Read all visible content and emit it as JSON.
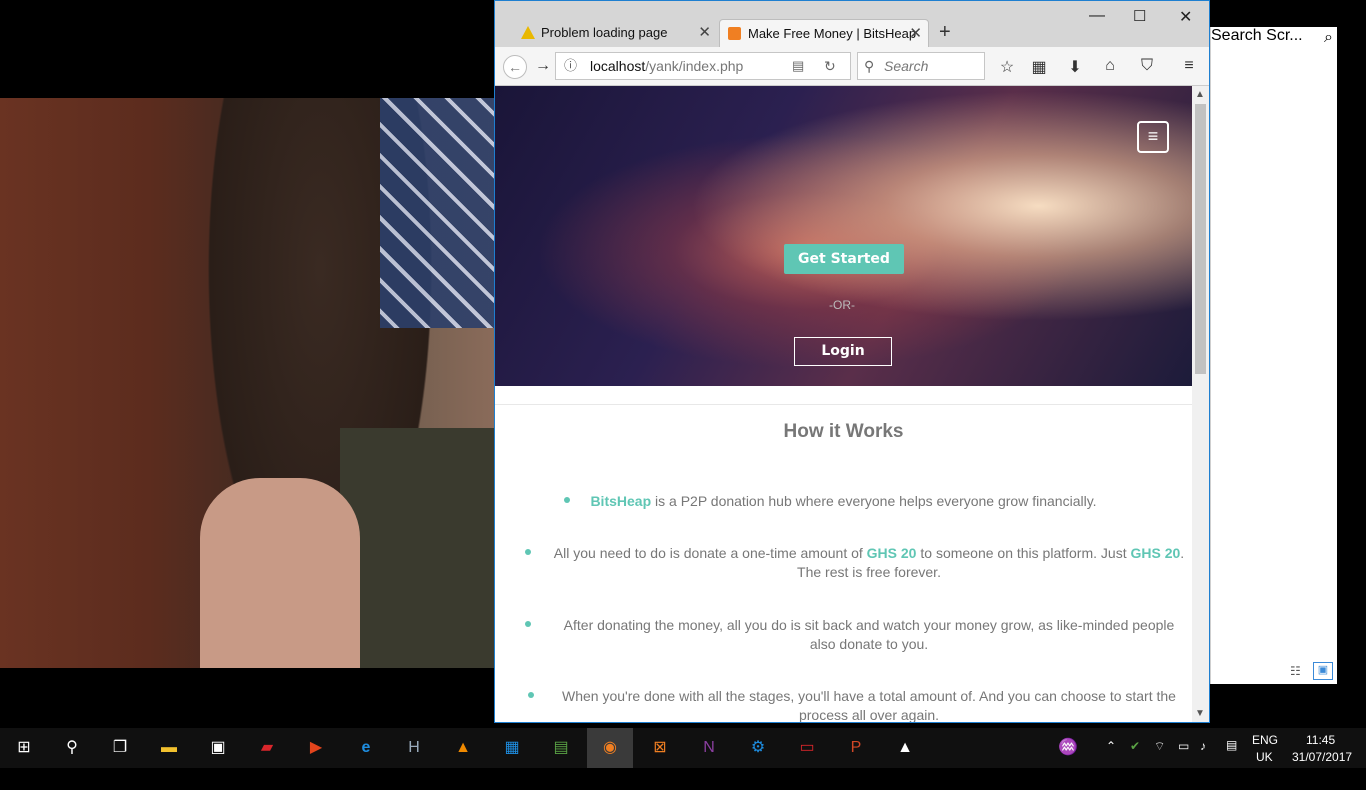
{
  "browser": {
    "tabs": [
      {
        "label": "Problem loading page",
        "icon": "warning-icon"
      },
      {
        "label": "Make Free Money | BitsHeap",
        "icon": "xampp-icon"
      }
    ],
    "url_host": "localhost",
    "url_path": "/yank/index.php",
    "search_placeholder": "Search"
  },
  "page": {
    "get_started_label": "Get Started",
    "or_label": "-OR-",
    "login_label": "Login",
    "how_title": "How it Works",
    "items": [
      {
        "parts": [
          "BitsHeap",
          " is a P2P donation hub where everyone helps everyone grow financially."
        ]
      },
      {
        "parts": [
          "All you need to do is donate a one-time amount of ",
          "GHS 20",
          " to someone on this platform. Just ",
          "GHS 20",
          ". The rest is free forever."
        ]
      },
      {
        "parts": [
          "After donating the money, all you do is sit back and watch your money grow, as like-minded people also donate to you."
        ]
      },
      {
        "parts": [
          "When you're done with all the stages, you'll have a total amount of. And you can choose to start the process all over again."
        ]
      }
    ]
  },
  "explorer": {
    "search_placeholder": "Search Scr..."
  },
  "taskbar": {
    "language": "ENG",
    "region": "UK",
    "time": "11:45",
    "date": "31/07/2017"
  },
  "colors": {
    "accent": "#5fc6b4",
    "window_border": "#1e7fd0"
  }
}
